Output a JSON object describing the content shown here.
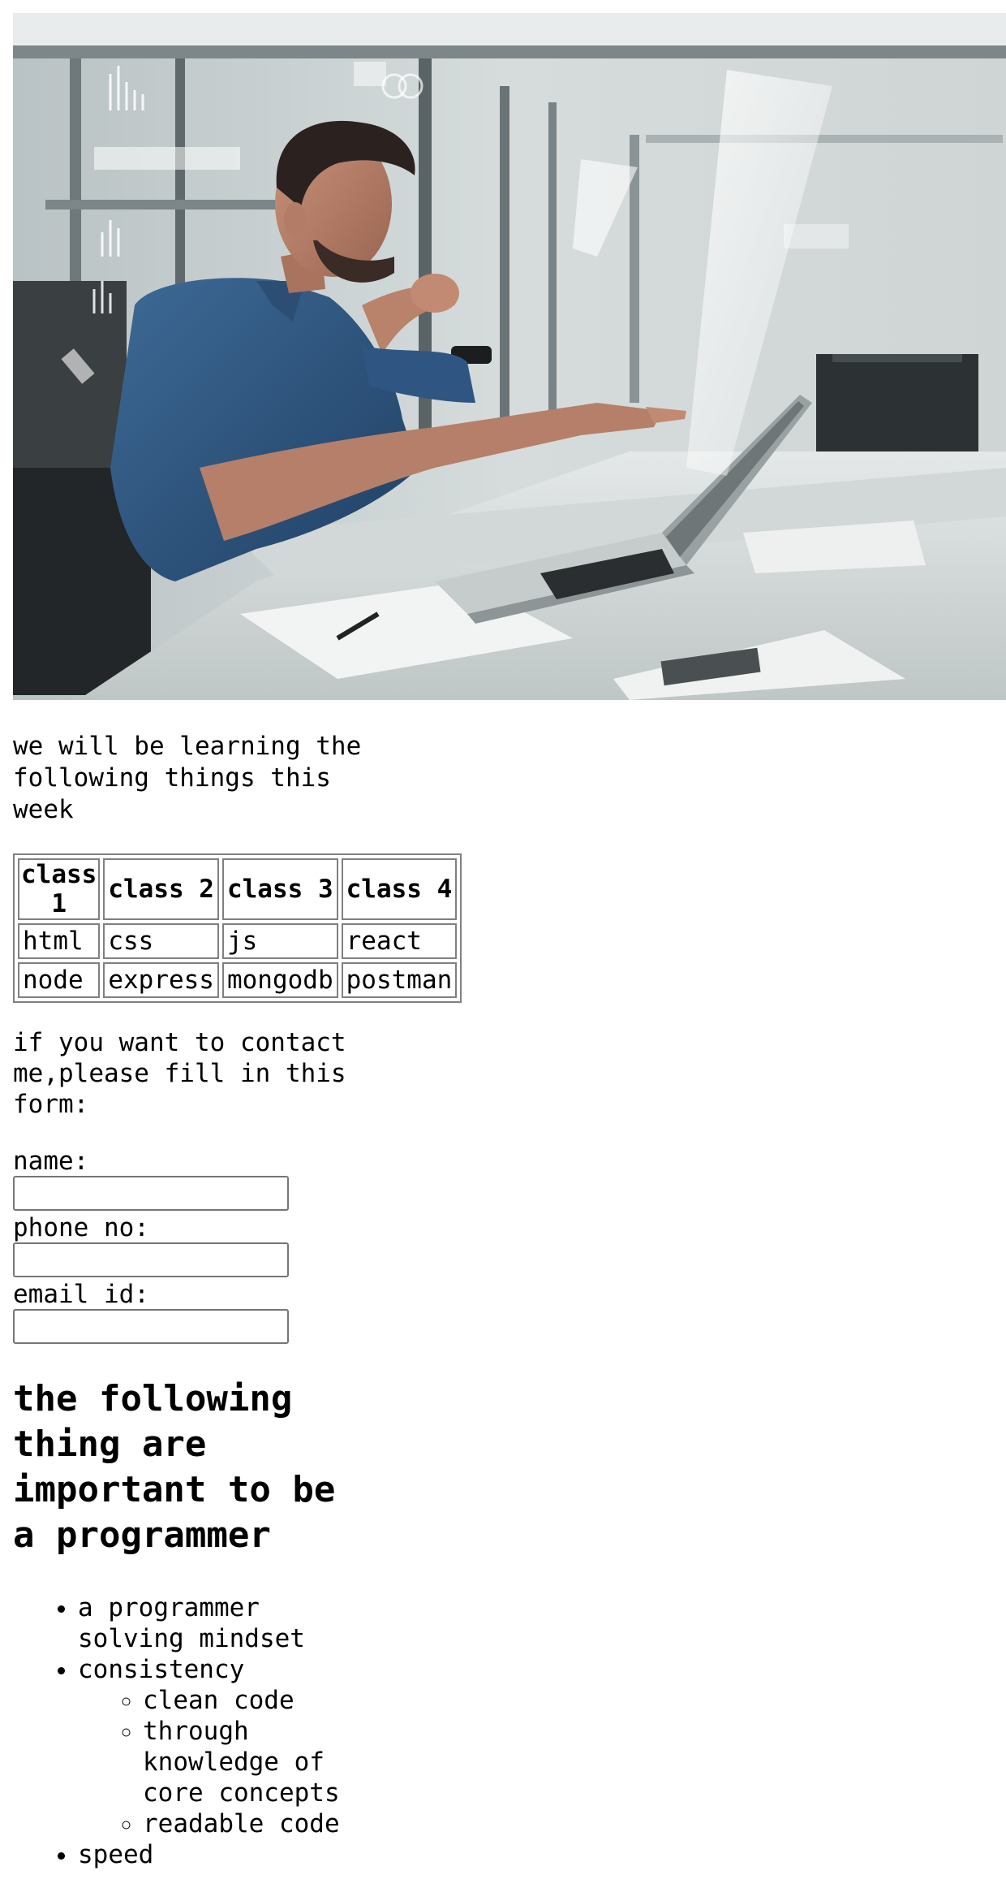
{
  "hero": {
    "icon": "programmer-photo-image"
  },
  "intro_text": "we will be learning the following things this week",
  "schedule": {
    "headers": [
      "class 1",
      "class 2",
      "class 3",
      "class 4"
    ],
    "rows": [
      [
        "html",
        "css",
        "js",
        "react"
      ],
      [
        "node",
        "express",
        "mongodb",
        "postman"
      ]
    ]
  },
  "contact_text": "if you want to contact me,please fill in this form:",
  "form": {
    "name_label": "name:",
    "name_value": "",
    "phone_label": "phone no:",
    "phone_value": "",
    "email_label": "email id:",
    "email_value": ""
  },
  "heading": "the following thing are important to be a programmer",
  "list": {
    "item1": "a programmer solving mindset",
    "item2": "consistency",
    "sub1": "clean code",
    "sub2": "through knowledge of core concepts",
    "sub3": "readable code",
    "item3": "speed"
  }
}
